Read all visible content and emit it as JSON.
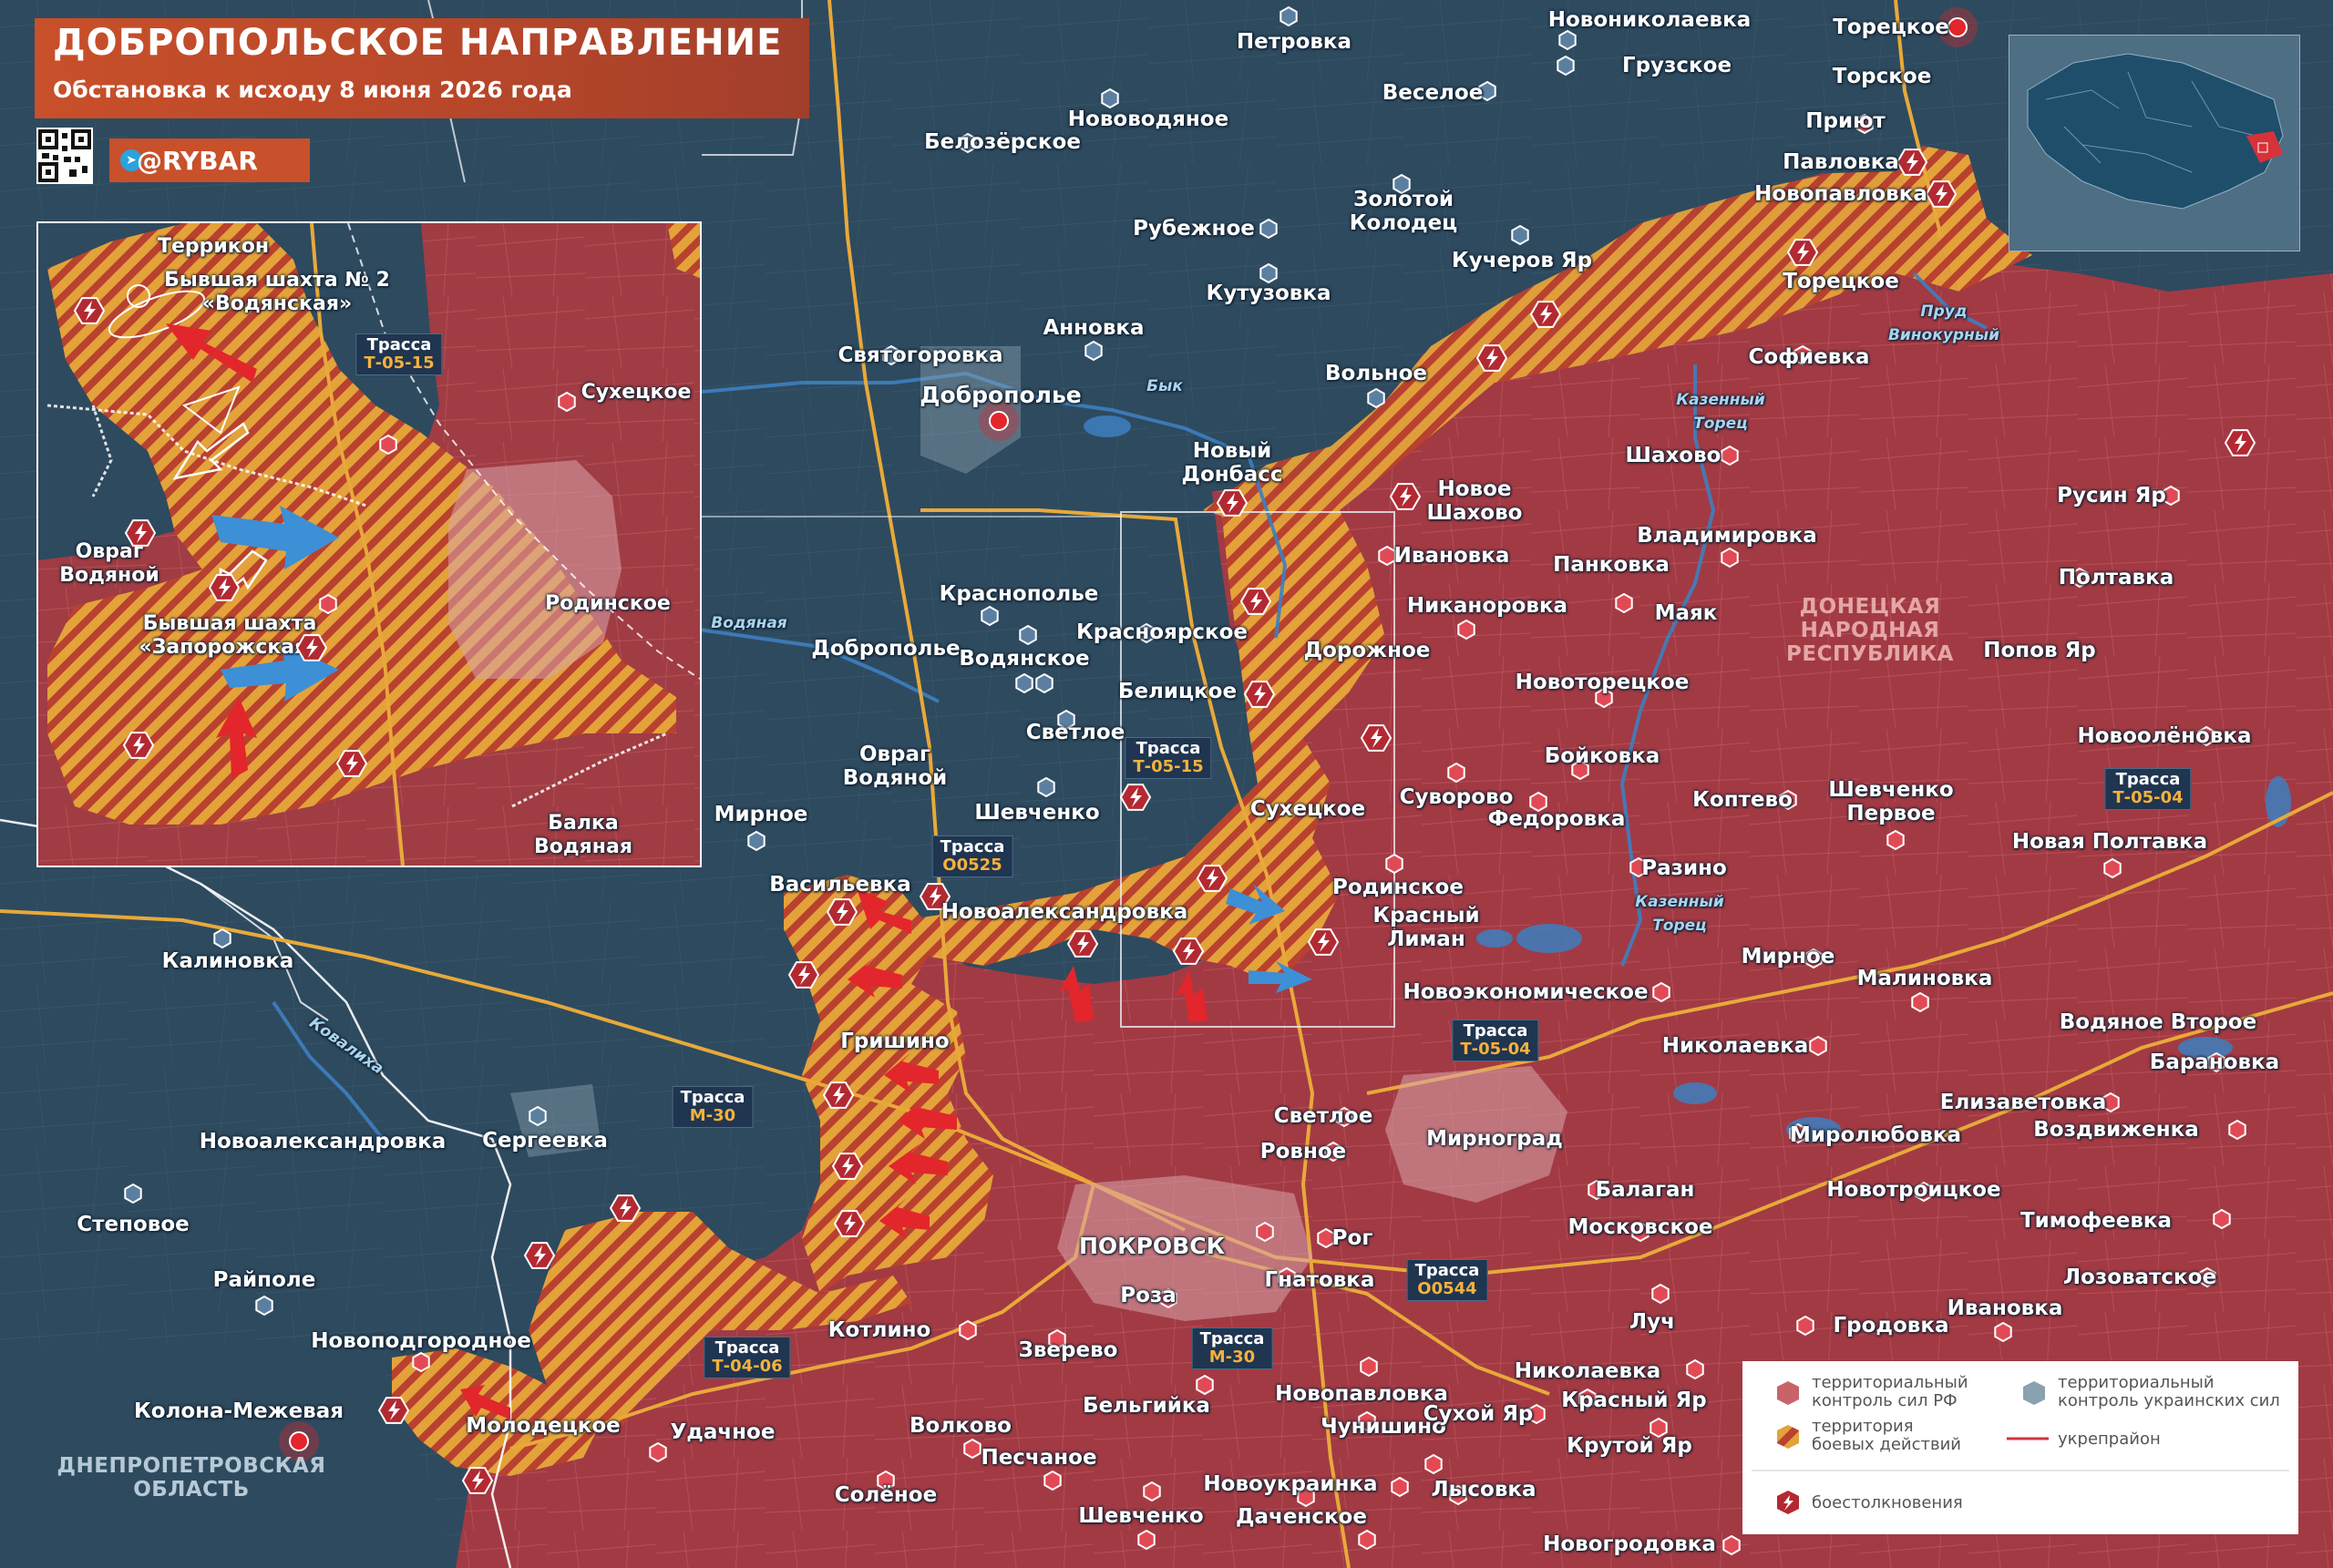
{
  "header": {
    "title": "ДОБРОПОЛЬСКОЕ НАПРАВЛЕНИЕ",
    "subtitle": "Обстановка к исходу 8 июня 2026 года",
    "brand": "@RYBAR",
    "brand_icon": "telegram-icon"
  },
  "colors": {
    "rf_control": "#a23a44",
    "ua_control": "#2d4a5e",
    "combat_zone_a": "#e3a23a",
    "combat_zone_b": "#b9412f",
    "attack_arrow": "#e3262b",
    "ua_arrow": "#3d8fd6",
    "road": "#e8a93a",
    "header_bg": "#c8502a"
  },
  "inset": {
    "labels": {
      "terrikon": "Террикон",
      "mine2": "Бывшая шахта № 2\n«Водянская»",
      "road": "Трасса",
      "road_code": "Т-05-15",
      "sukhetskoe": "Сухецкое",
      "ovrag": "Овраг\nВодяной",
      "rodinskoe": "Родинское",
      "mine_zap": "Бывшая шахта\n«Запорожская»",
      "balka": "Балка\nВодяная"
    }
  },
  "places": {
    "petrovka": "Петровка",
    "novonikolaevka": "Новониколаевка",
    "gruzskoe": "Грузское",
    "toretskoe_top": "Торецкое",
    "torskoe": "Торское",
    "priyut": "Приют",
    "pavlovka": "Павловка",
    "novopavlovka_ne": "Новопавловка",
    "toretskoe_mid": "Торецкое",
    "belozerskoe": "Белозёрское",
    "novovodyanoe": "Нововодяное",
    "veseloe": "Веселое",
    "zolotoy_kolodets": "Золотой\nКолодец",
    "rubezhnoe": "Рубежное",
    "kucherov_yar": "Кучеров Яр",
    "kutuzovka": "Кутузовка",
    "annovka": "Анновка",
    "svyatogorovka": "Святогоровка",
    "dobropolie": "Доброполье",
    "volnoe": "Вольное",
    "sofievka": "Софиевка",
    "novy_donbass": "Новый\nДонбасс",
    "novoe_shakhovo": "Новое\nШахово",
    "shakhovo": "Шахово",
    "rusin_yar": "Русин Яр",
    "ivanovka": "Ивановка",
    "pankovka": "Панковка",
    "vladimirovka": "Владимировка",
    "poltavka": "Полтавка",
    "nikanorovka": "Никаноровка",
    "mayak": "Маяк",
    "popov_yar": "Попов Яр",
    "krasnopolie": "Краснополье",
    "dobropolie_s": "Доброполье",
    "vodyanskoe": "Водянское",
    "krasnoyarskoe": "Красноярское",
    "dorozhnoe": "Дорожное",
    "belitskoe": "Белицкое",
    "novotoretskoe": "Новоторецкое",
    "svetloe": "Светлое",
    "boykovka": "Бойковка",
    "novoolenovka": "Новоолёновка",
    "ovrag_vodyanoy": "Овраг\nВодяной",
    "shevchenko": "Шевченко",
    "sukhetskoe": "Сухецкое",
    "suvorovo": "Суворово",
    "fedorovka": "Федоровка",
    "koptevo": "Коптево",
    "shevchenko_pervoe": "Шевченко\nПервое",
    "novaya_poltavka": "Новая Полтавка",
    "mirnoe_w": "Мирное",
    "vasilievka": "Васильевка",
    "novoaleksandrovka": "Новоалександровка",
    "rodinskoe": "Родинское",
    "krasny_liman": "Красный\nЛиман",
    "razino": "Разино",
    "kalinovka": "Калиновка",
    "mirnoe_e": "Мирное",
    "malinovka": "Малиновка",
    "novoekonomicheskoe": "Новоэкономическое",
    "vodyanoe_vtoroe": "Водяное Второе",
    "grishino": "Гришино",
    "nikolaevka_e": "Николаевка",
    "baranovka": "Барановка",
    "elizavetovka": "Елизаветовка",
    "novoaleksandrovka_w": "Новоалександровка",
    "sergeevka": "Сергеевка",
    "svetloe_s": "Светлое",
    "mirnograd": "Мирноград",
    "mirolyubovka": "Миролюбовка",
    "vozdvizhenka": "Воздвиженка",
    "rovnoe": "Ровное",
    "balagan": "Балаган",
    "novotroitskoe": "Новотроицкое",
    "stepovoe": "Степовое",
    "moskovskoe": "Московское",
    "timofeevka": "Тимофеевка",
    "pokrovsk": "ПОКРОВСК",
    "rog": "Рог",
    "raypole": "Райполе",
    "gnatovka": "Гнатовка",
    "lozovatskoe": "Лозоватское",
    "roza": "Роза",
    "luch": "Луч",
    "ivanovka_e": "Ивановка",
    "kotlino": "Котлино",
    "grodovka": "Гродовка",
    "novopodgorodnoe": "Новоподгородное",
    "zverevo": "Зверево",
    "nikolaevka_s": "Николаевка",
    "kolona_mezhevaya": "Колона-Межевая",
    "belgiyka": "Бельгийка",
    "novopavlovka_s": "Новопавловка",
    "krasny_yar": "Красный Яр",
    "molodetskoe": "Молодецкое",
    "udachnoe": "Удачное",
    "volkovo": "Волково",
    "chunishino": "Чунишино",
    "sukhoy_yar": "Сухой Яр",
    "krutoy_yar": "Крутой Яр",
    "peschanoe": "Песчаное",
    "novoukrainka": "Новоукраинка",
    "lysovka": "Лысовка",
    "solenoe": "Солёное",
    "shevchenko_s": "Шевченко",
    "dachenskoe": "Даченское",
    "novogrodovka": "Новогродовка"
  },
  "regions": {
    "dnr": "ДОНЕЦКАЯ\nНАРОДНАЯ\nРЕСПУБЛИКА",
    "dnepr": "ДНЕПРОПЕТРОВСКАЯ\nОБЛАСТЬ"
  },
  "rivers": {
    "byk": "Бык",
    "prud": "Пруд\nВинокурный",
    "kazenny_torets_n": "Казенный\nТорец",
    "kazenny_torets_s": "Казенный\nТорец",
    "vodyanaya": "Водяная",
    "kovalikha": "Ковалиха"
  },
  "roads": {
    "road_label": "Трасса",
    "t0515": "Т-05-15",
    "o0525": "О0525",
    "t0504_e": "Т-05-04",
    "t0504": "Т-05-04",
    "m30_w": "М-30",
    "o0544": "О0544",
    "m30_s": "М-30",
    "t0406": "Т-04-06"
  },
  "legend": {
    "rf": "территориальный\nконтроль сил РФ",
    "ua": "территориальный\nконтроль украинских сил",
    "combat": "территория\nбоевых действий",
    "fort": "укрепрайон",
    "clash": "боестолкновения"
  }
}
